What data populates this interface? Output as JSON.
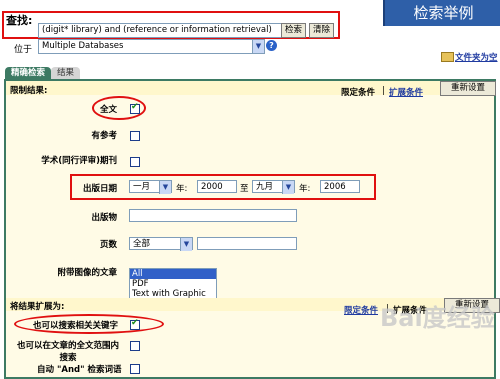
{
  "header": {
    "search_label": "查找:",
    "search_value": "(digit* library) and (reference or information retrieval)",
    "search_button": "检索",
    "clear_button": "清除",
    "example_title": "检索举例"
  },
  "database": {
    "label": "位于",
    "selected": "Multiple Databases",
    "help_icon": "?",
    "folder_link": "文件夹为空"
  },
  "tabs": [
    {
      "label": "精确检索"
    },
    {
      "label": "结果"
    }
  ],
  "limit": {
    "title": "限制结果:",
    "link_limit": "限定条件",
    "separator": "|",
    "link_expand": "扩展条件",
    "reset": "重新设置",
    "fulltext_label": "全文",
    "references_label": "有参考",
    "peer_label": "学术(同行评审)期刊",
    "date_label": "出版日期",
    "from_month": "一月",
    "year_label_1": "年:",
    "from_year": "2000",
    "to_label": "至",
    "to_month": "九月",
    "year_label_2": "年:",
    "to_year": "2006",
    "publication_label": "出版物",
    "pages_label": "页数",
    "pages_option": "全部",
    "image_label": "附带图像的文章",
    "image_options": [
      "All",
      "PDF",
      "Text with Graphic"
    ]
  },
  "expand": {
    "title": "将结果扩展为:",
    "link_limit": "限定条件",
    "separator": "|",
    "link_expand": "扩展条件",
    "reset": "重新设置",
    "related_label": "也可以搜索相关关键字",
    "fulltext_search_label_1": "也可以在文章的全文范围内",
    "fulltext_search_label_2": "搜索",
    "auto_and_label": "自动 \"And\" 检索词语"
  },
  "watermark": "Bai度经验"
}
